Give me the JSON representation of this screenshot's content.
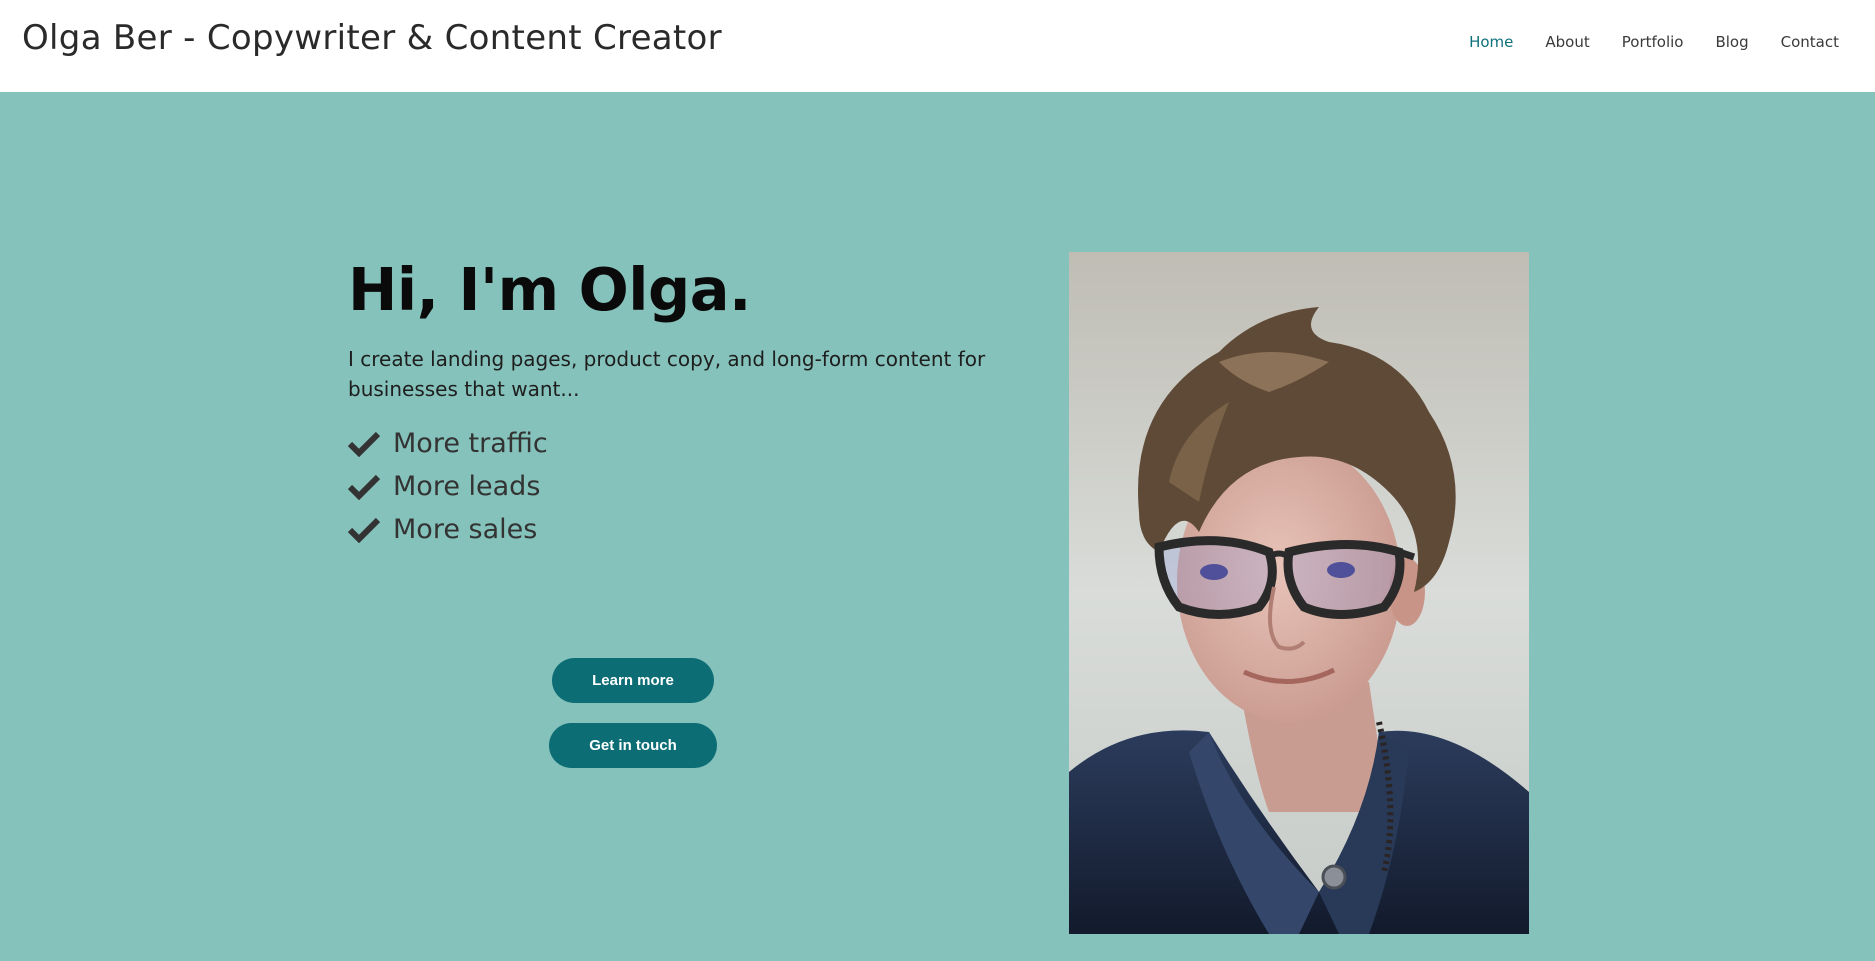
{
  "header": {
    "site_title": "Olga Ber - Copywriter & Content Creator",
    "nav": [
      {
        "label": "Home",
        "active": true
      },
      {
        "label": "About",
        "active": false
      },
      {
        "label": "Portfolio",
        "active": false
      },
      {
        "label": "Blog",
        "active": false
      },
      {
        "label": "Contact",
        "active": false
      }
    ]
  },
  "hero": {
    "heading": "Hi, I'm Olga.",
    "intro": "I create landing pages, product copy, and long-form content for businesses that want...",
    "benefits": [
      {
        "label": "More traffic",
        "icon": "check-icon"
      },
      {
        "label": "More leads",
        "icon": "check-icon"
      },
      {
        "label": "More sales",
        "icon": "check-icon"
      }
    ],
    "buttons": {
      "learn_more": "Learn more",
      "get_in_touch": "Get in touch"
    },
    "portrait": {
      "icon": "portrait-photo"
    }
  },
  "colors": {
    "background": "#85c2bb",
    "header_bg": "#ffffff",
    "accent": "#0d6d75",
    "nav_active": "#0e7179",
    "heading": "#0a0a0a",
    "text": "#333333"
  }
}
